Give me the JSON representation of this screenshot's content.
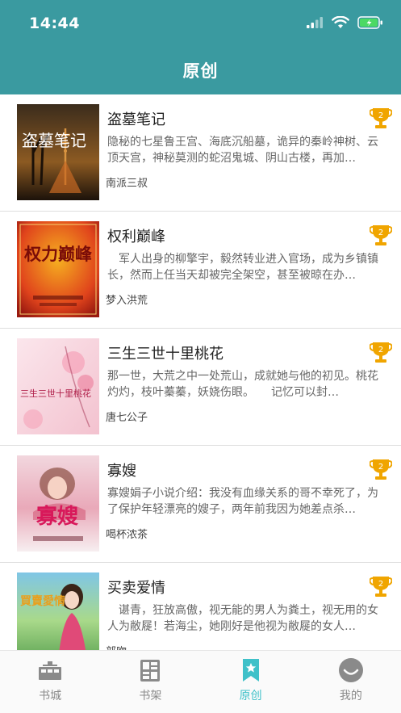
{
  "status": {
    "time": "14:44"
  },
  "header": {
    "title": "原创"
  },
  "colors": {
    "header_bg": "#3a9aa0",
    "tab_active": "#3fc1c9",
    "tab_inactive": "#8a8a8a",
    "trophy": "#f0a500"
  },
  "books": [
    {
      "title": "盗墓笔记",
      "description": "隐秘的七星鲁王宫、海底沉船墓，诡异的秦岭神树、云顶天宫，神秘莫测的蛇沼鬼城、阴山古楼，再加…",
      "author": "南派三叔",
      "rank": "2",
      "cover_text": "盗墓笔记"
    },
    {
      "title": "权利巅峰",
      "description": "　军人出身的柳擎宇，毅然转业进入官场，成为乡镇镇长，然而上任当天却被完全架空，甚至被晾在办…",
      "author": "梦入洪荒",
      "rank": "2",
      "cover_text": "权力巅峰"
    },
    {
      "title": "三生三世十里桃花",
      "description": "那一世，大荒之中一处荒山，成就她与他的初见。桃花灼灼，枝叶蓁蓁，妖娆伤眼。　　记忆可以封…",
      "author": "唐七公子",
      "rank": "2",
      "cover_text": "三生三世十里桃花"
    },
    {
      "title": "寡嫂",
      "description": "寡嫂娟子小说介绍：我没有血缘关系的哥不幸死了，为了保护年轻漂亮的嫂子，两年前我因为她差点杀…",
      "author": "喝杯浓茶",
      "rank": "2",
      "cover_text": "寡嫂"
    },
    {
      "title": "买卖爱情",
      "description": "　谌青，狂放高傲，视无能的男人为粪土，视无用的女人为敝屣！若海尘，她刚好是他视为敝屣的女人…",
      "author": "部吻",
      "rank": "2",
      "cover_text": "買賣愛情"
    }
  ],
  "tabs": [
    {
      "label": "书城",
      "icon": "bookstore-icon",
      "active": false
    },
    {
      "label": "书架",
      "icon": "bookshelf-icon",
      "active": false
    },
    {
      "label": "原创",
      "icon": "original-icon",
      "active": true
    },
    {
      "label": "我的",
      "icon": "profile-icon",
      "active": false
    }
  ]
}
